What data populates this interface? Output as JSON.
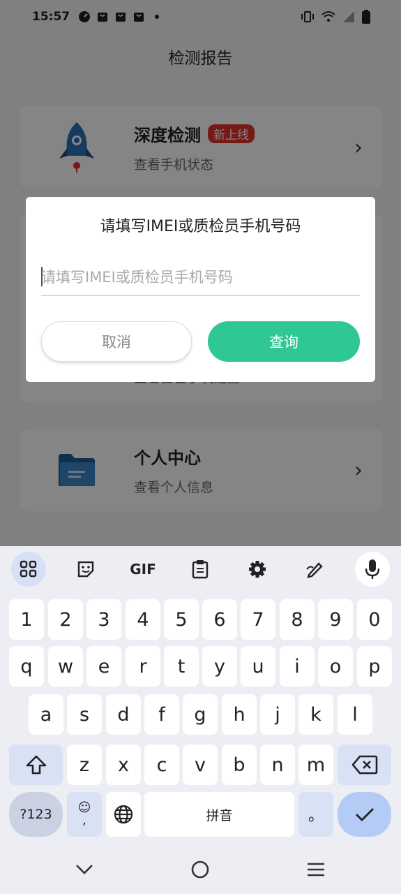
{
  "status_bar": {
    "time": "15:57"
  },
  "page": {
    "title": "检测报告",
    "cards": [
      {
        "title": "深度检测",
        "badge": "新上线",
        "subtitle": "查看手机状态"
      },
      {
        "title": "个人中心",
        "subtitle": "查看个人信息"
      }
    ],
    "hidden_card_subtitle": "查看自己手机配置"
  },
  "dialog": {
    "title": "请填写IMEI或质检员手机号码",
    "input_placeholder": "请填写IMEI或质检员手机号码",
    "input_value": "",
    "cancel_label": "取消",
    "query_label": "查询"
  },
  "keyboard": {
    "toolbar": {
      "gif_label": "GIF"
    },
    "row_numbers": [
      "1",
      "2",
      "3",
      "4",
      "5",
      "6",
      "7",
      "8",
      "9",
      "0"
    ],
    "row1": [
      "q",
      "w",
      "e",
      "r",
      "t",
      "y",
      "u",
      "i",
      "o",
      "p"
    ],
    "row2": [
      "a",
      "s",
      "d",
      "f",
      "g",
      "h",
      "j",
      "k",
      "l"
    ],
    "row3": [
      "z",
      "x",
      "c",
      "v",
      "b",
      "n",
      "m"
    ],
    "symbols_label": "?123",
    "emoji_label": "☺",
    "comma_label": ",",
    "space_label": "拼音",
    "period_label": "。"
  },
  "colors": {
    "accent": "#2ec795",
    "badge": "#e0332a",
    "keyboard_bg": "#edeef4"
  }
}
